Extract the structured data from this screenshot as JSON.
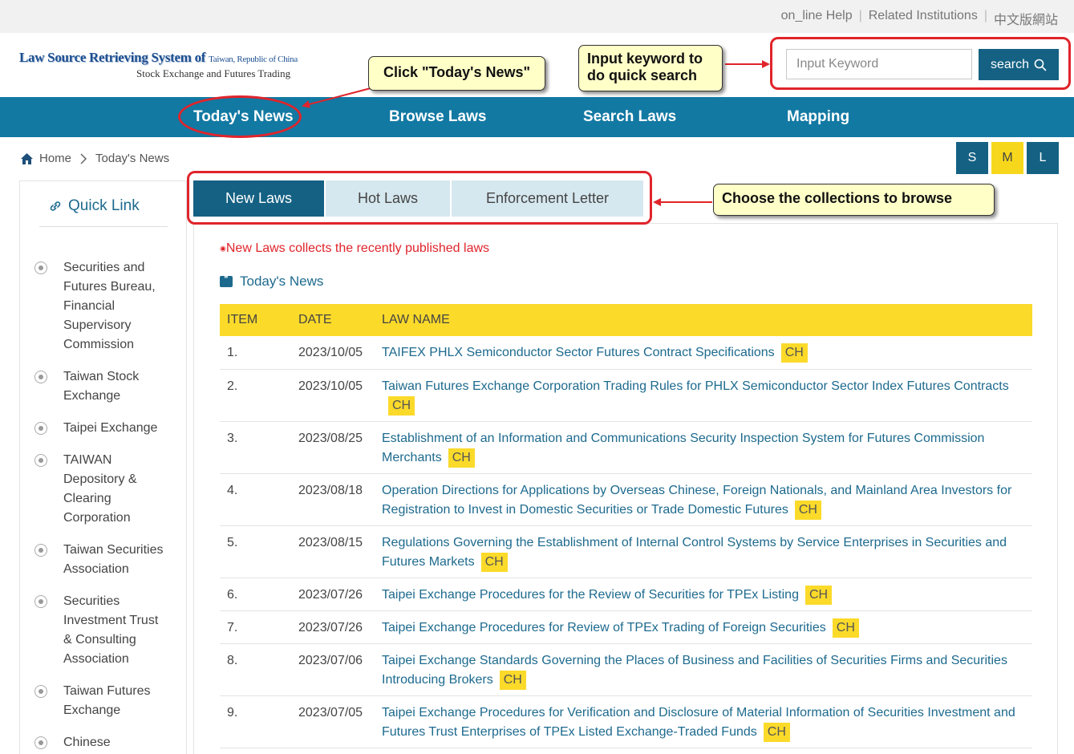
{
  "top_links": [
    "on_line Help",
    "Related Institutions",
    "中文版網站"
  ],
  "logo": {
    "line1_main": "Law Source Retrieving System of",
    "line1_small": "Taiwan, Republic of China",
    "line2": "Stock Exchange and Futures Trading"
  },
  "search": {
    "placeholder": "Input Keyword",
    "button_label": "search"
  },
  "nav": [
    "Today's News",
    "Browse Laws",
    "Search Laws",
    "Mapping"
  ],
  "breadcrumb": [
    "Home",
    "Today's News"
  ],
  "font_sizes": [
    "S",
    "M",
    "L"
  ],
  "sidebar": {
    "title": "Quick Link",
    "items": [
      [
        "Securities and",
        "Futures Bureau,",
        "Financial",
        "Supervisory",
        "Commission"
      ],
      [
        "Taiwan Stock",
        "Exchange"
      ],
      [
        "Taipei Exchange"
      ],
      [
        "TAIWAN",
        "Depository &",
        "Clearing",
        "Corporation"
      ],
      [
        "Taiwan Securities",
        "Association"
      ],
      [
        "Securities",
        "Investment Trust",
        "& Consulting",
        "Association"
      ],
      [
        "Taiwan Futures",
        "Exchange"
      ],
      [
        "Chinese"
      ]
    ]
  },
  "tabs": [
    "New Laws",
    "Hot Laws",
    "Enforcement Letter"
  ],
  "notice": "New Laws collects the recently published laws",
  "section_title": "Today's News",
  "table": {
    "headers": [
      "ITEM",
      "DATE",
      "LAW NAME"
    ],
    "ch_label": "CH",
    "rows": [
      {
        "item": "1.",
        "date": "2023/10/05",
        "name": "TAIFEX PHLX Semiconductor Sector Futures Contract Specifications"
      },
      {
        "item": "2.",
        "date": "2023/10/05",
        "name": "Taiwan Futures Exchange Corporation Trading Rules for PHLX Semiconductor Sector Index Futures Contracts"
      },
      {
        "item": "3.",
        "date": "2023/08/25",
        "name": "Establishment of an Information and Communications Security Inspection System for Futures Commission Merchants"
      },
      {
        "item": "4.",
        "date": "2023/08/18",
        "name": "Operation Directions for Applications by Overseas Chinese, Foreign Nationals, and Mainland Area Investors for Registration to Invest in Domestic Securities or Trade Domestic Futures"
      },
      {
        "item": "5.",
        "date": "2023/08/15",
        "name": "Regulations Governing the Establishment of Internal Control Systems by Service Enterprises in Securities and Futures Markets"
      },
      {
        "item": "6.",
        "date": "2023/07/26",
        "name": "Taipei Exchange Procedures for the Review of Securities for TPEx Listing"
      },
      {
        "item": "7.",
        "date": "2023/07/26",
        "name": "Taipei Exchange Procedures for Review of TPEx Trading of Foreign Securities"
      },
      {
        "item": "8.",
        "date": "2023/07/06",
        "name": "Taipei Exchange Standards Governing the Places of Business and Facilities of Securities Firms and Securities Introducing Brokers"
      },
      {
        "item": "9.",
        "date": "2023/07/05",
        "name": "Taipei Exchange Procedures for Verification and Disclosure of Material Information of Securities Investment and Futures Trust Enterprises of TPEx Listed Exchange-Traded Funds"
      }
    ]
  },
  "callouts": {
    "todays_news": "Click \"Today's News\"",
    "keyword_1": "Input keyword to",
    "keyword_2": "do quick search",
    "collections": "Choose the collections to browse"
  },
  "colors": {
    "nav": "#1279a3",
    "primary": "#146183",
    "highlight": "#fbda2a",
    "annotation": "#e0242b",
    "callout_bg": "#ffffc8"
  }
}
